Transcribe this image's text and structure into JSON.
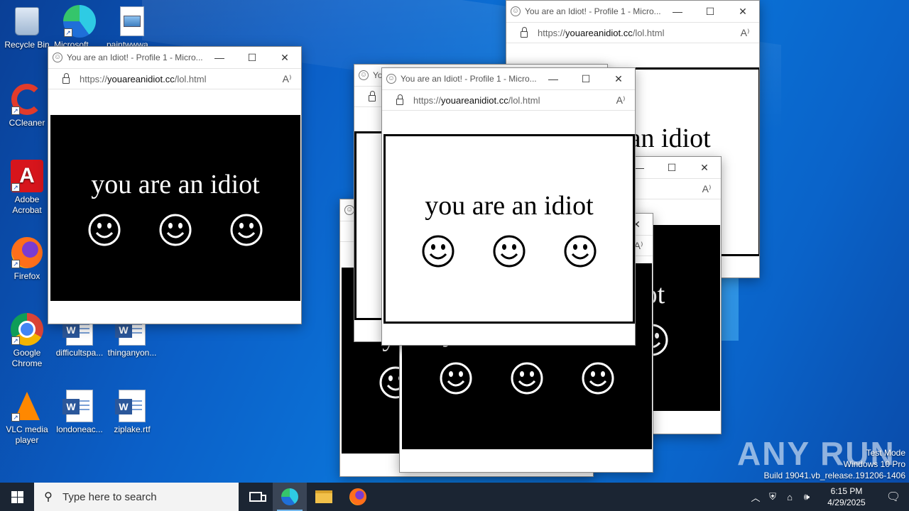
{
  "desktop": {
    "icons": [
      {
        "label": "Recycle Bin"
      },
      {
        "label": "Microsoft Edge"
      },
      {
        "label": "paintwwwaag..."
      },
      {
        "label": "CCleaner"
      },
      {
        "label": "Adobe Acrobat"
      },
      {
        "label": "Firefox"
      },
      {
        "label": "Google Chrome"
      },
      {
        "label": "difficultspa..."
      },
      {
        "label": "thinganyon..."
      },
      {
        "label": "VLC media player"
      },
      {
        "label": "londoneac..."
      },
      {
        "label": "ziplake.rtf"
      }
    ]
  },
  "browser": {
    "title": "You are an Idiot! - Profile 1 - Micro...",
    "url_prefix": "https://",
    "url_domain": "youareanidiot.cc",
    "url_path": "/lol.html",
    "minimize": "—",
    "maximize": "☐",
    "close": "✕",
    "read_aloud": "A⁾"
  },
  "page": {
    "message": "you are an idiot"
  },
  "watermark": {
    "brand": "ANY RUN",
    "line1": "Test Mode",
    "line2": "Windows 10 Pro",
    "line3": "Build 19041.vb_release.191206-1406"
  },
  "taskbar": {
    "search_placeholder": "Type here to search",
    "time": "6:15 PM",
    "date": "4/29/2025"
  }
}
